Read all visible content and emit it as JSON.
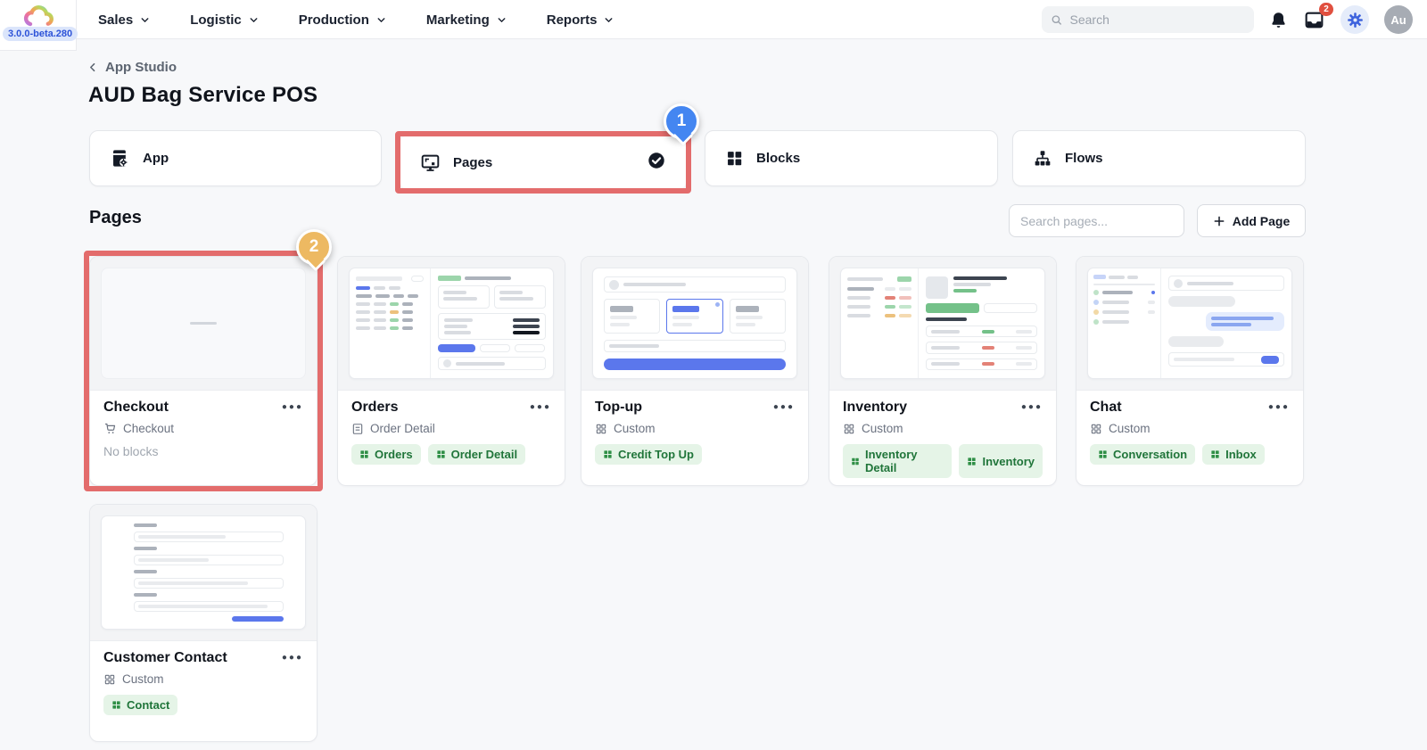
{
  "app": {
    "version_badge": "3.0.0-beta.280",
    "nav": [
      {
        "label": "Sales"
      },
      {
        "label": "Logistic"
      },
      {
        "label": "Production"
      },
      {
        "label": "Marketing"
      },
      {
        "label": "Reports"
      }
    ],
    "search_placeholder": "Search",
    "notification_badge": "2",
    "avatar_initials": "Au"
  },
  "breadcrumb": {
    "back_label": "App Studio"
  },
  "page": {
    "title": "AUD Bag Service POS"
  },
  "tabs": [
    {
      "label": "App",
      "icon": "app-icon",
      "selected": false
    },
    {
      "label": "Pages",
      "icon": "pages-icon",
      "selected": true
    },
    {
      "label": "Blocks",
      "icon": "blocks-icon",
      "selected": false
    },
    {
      "label": "Flows",
      "icon": "flows-icon",
      "selected": false
    }
  ],
  "annotations": {
    "step1_label": "1",
    "step2_label": "2",
    "step1_color": "#4486f1",
    "step2_color": "#edb962",
    "box_color": "#e36c6c"
  },
  "pages_section": {
    "heading": "Pages",
    "search_placeholder": "Search pages...",
    "add_button_label": "Add Page",
    "cards": [
      {
        "title": "Checkout",
        "subtitle": "Checkout",
        "subtitle_icon": "cart-icon",
        "status": "No blocks",
        "tags": [],
        "thumbnail": "empty"
      },
      {
        "title": "Orders",
        "subtitle": "Order Detail",
        "subtitle_icon": "document-icon",
        "tags": [
          {
            "label": "Orders"
          },
          {
            "label": "Order Detail"
          }
        ],
        "thumbnail": "list-detail"
      },
      {
        "title": "Top-up",
        "subtitle": "Custom",
        "subtitle_icon": "grid-icon",
        "tags": [
          {
            "label": "Credit Top Up"
          }
        ],
        "thumbnail": "option-form"
      },
      {
        "title": "Inventory",
        "subtitle": "Custom",
        "subtitle_icon": "grid-icon",
        "tags": [
          {
            "label": "Inventory Detail"
          },
          {
            "label": "Inventory"
          }
        ],
        "thumbnail": "inventory"
      },
      {
        "title": "Chat",
        "subtitle": "Custom",
        "subtitle_icon": "grid-icon",
        "tags": [
          {
            "label": "Conversation"
          },
          {
            "label": "Inbox"
          }
        ],
        "thumbnail": "chat"
      },
      {
        "title": "Customer Contact",
        "subtitle": "Custom",
        "subtitle_icon": "grid-icon",
        "tags": [
          {
            "label": "Contact"
          }
        ],
        "thumbnail": "form"
      }
    ]
  },
  "colors": {
    "accent_blue": "#5b77ec",
    "tag_green_bg": "#e5f4e7",
    "tag_green_text": "#20753a",
    "annotation_red": "#e36c6c",
    "notification_red": "#e04f3f"
  }
}
